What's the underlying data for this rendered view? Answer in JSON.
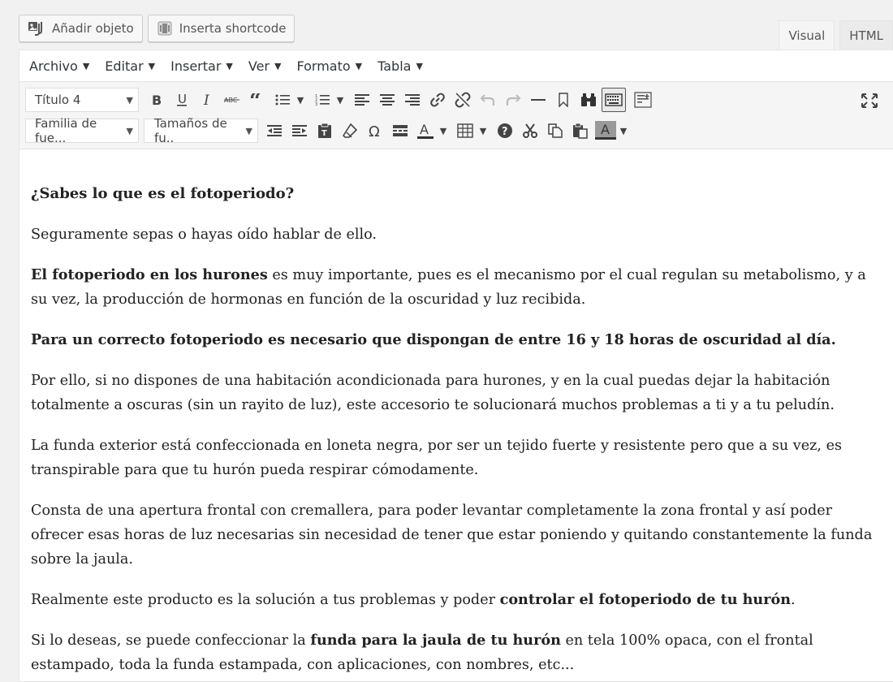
{
  "media": {
    "add_object": "Añadir objeto",
    "insert_shortcode": "Inserta shortcode"
  },
  "tabs": {
    "visual": "Visual",
    "html": "HTML"
  },
  "menubar": {
    "items": [
      "Archivo",
      "Editar",
      "Insertar",
      "Ver",
      "Formato",
      "Tabla"
    ]
  },
  "toolbar": {
    "format_select": "Título 4",
    "font_family": "Familia de fue...",
    "font_size": "Tamaños de fu..",
    "icons_row1": [
      "bold-icon",
      "underline-icon",
      "italic-icon",
      "strikethrough-icon",
      "blockquote-icon",
      "bullet-list-icon",
      "numbered-list-icon",
      "align-left-icon",
      "align-center-icon",
      "align-right-icon",
      "link-icon",
      "unlink-icon",
      "undo-icon",
      "redo-icon",
      "horizontal-line-icon",
      "bookmark-icon",
      "find-replace-icon",
      "toolbar-toggle-icon",
      "read-more-icon",
      "fullscreen-icon"
    ],
    "icons_row2": [
      "outdent-icon",
      "indent-icon",
      "paste-text-icon",
      "clear-format-icon",
      "special-char-icon",
      "page-break-icon",
      "text-color-icon",
      "table-icon",
      "help-icon",
      "cut-icon",
      "copy-icon",
      "paste-icon",
      "background-color-icon"
    ]
  },
  "content": {
    "heading": "¿Sabes lo que es el fotoperiodo?",
    "p1": "Seguramente sepas o hayas oído hablar de ello.",
    "p2_bold": "El fotoperiodo en los hurones",
    "p2_rest": " es muy importante, pues es el mecanismo por el cual regulan su metabolismo, y a su vez, la producción de hormonas en función de la oscuridad y luz recibida.",
    "p3_bold": "Para un correcto fotoperiodo es necesario que dispongan de entre 16 y 18 horas de oscuridad al día.",
    "p4": "Por ello, si no dispones de una habitación acondicionada para hurones, y en la cual puedas dejar la habitación totalmente a oscuras (sin un rayito de luz), este accesorio te solucionará muchos problemas a ti y a tu peludín.",
    "p5": "La funda exterior está confeccionada en loneta negra, por ser un tejido fuerte y resistente pero que a su vez, es transpirable para que tu hurón pueda respirar cómodamente.",
    "p6": "Consta de una apertura frontal con cremallera, para poder levantar completamente la zona frontal y así poder ofrecer esas horas de luz necesarias sin necesidad de tener que estar poniendo y quitando constantemente la funda sobre la jaula.",
    "p7_start": "Realmente este producto es la solución a tus problemas y poder ",
    "p7_bold": "controlar el fotoperiodo de tu hurón",
    "p7_end": ".",
    "p8_start": "Si lo deseas, se puede confeccionar la ",
    "p8_bold": "funda para la jaula de tu hurón",
    "p8_end": " en tela 100% opaca, con el frontal estampado, toda la funda estampada, con aplicaciones, con nombres, etc..."
  }
}
